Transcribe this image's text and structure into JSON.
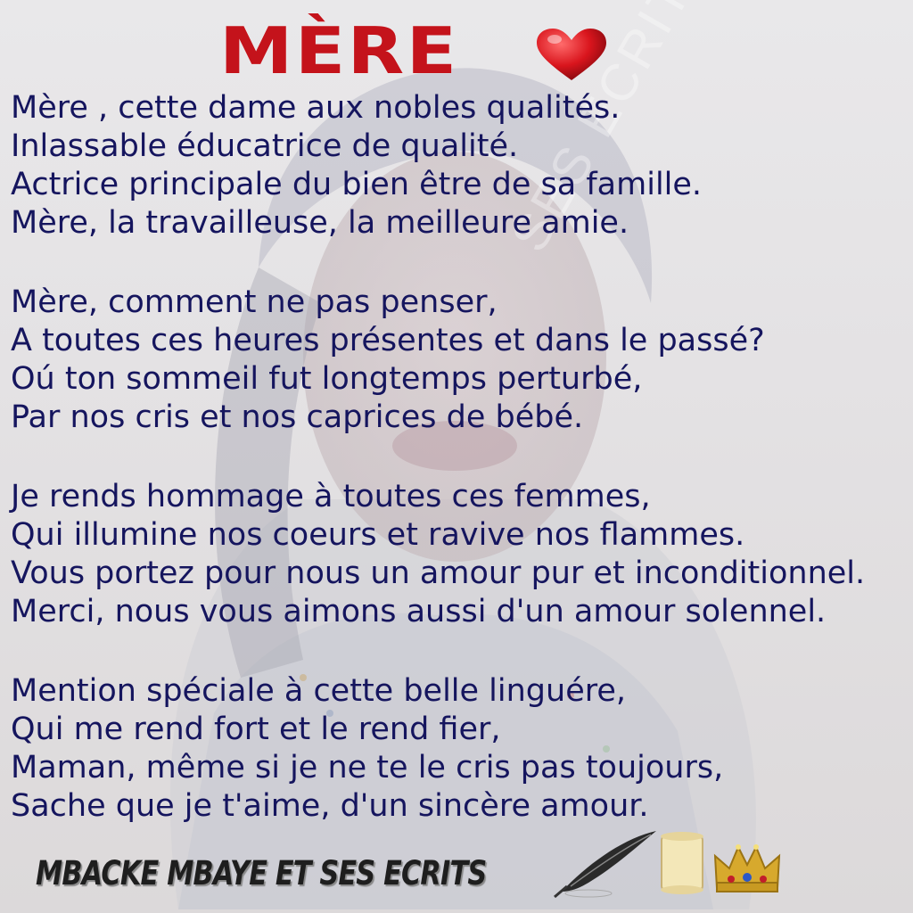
{
  "title": "MÈRE",
  "poem": {
    "stanzas": [
      [
        "Mère , cette dame aux nobles qualités.",
        "Inlassable éducatrice de qualité.",
        "Actrice  principale du bien être de sa famille.",
        "Mère, la travailleuse, la meilleure amie."
      ],
      [
        "Mère, comment ne pas penser,",
        "A toutes ces heures présentes et dans le passé?",
        "Oú ton sommeil fut longtemps perturbé,",
        "Par nos cris et nos caprices de bébé."
      ],
      [
        "Je rends hommage à toutes ces femmes,",
        "Qui illumine nos coeurs et ravive nos flammes.",
        "Vous portez pour nous un amour pur et inconditionnel.",
        "Merci, nous vous aimons aussi d'un amour solennel."
      ],
      [
        "Mention spéciale à cette belle linguére,",
        "Qui me rend fort et le rend fier,",
        "Maman, même si je ne te le cris pas toujours,",
        "Sache que je t'aime, d'un sincère amour."
      ]
    ]
  },
  "signature": "MBACKE MBAYE ET SES ECRITS",
  "watermark": "SES ECRITS",
  "icons": [
    "heart-icon",
    "quill-icon",
    "scroll-icon",
    "crown-icon"
  ],
  "colors": {
    "title": "#c4131b",
    "heart": "#d9151d",
    "poem_text": "#15155e",
    "signature": "#1e1e1e"
  }
}
